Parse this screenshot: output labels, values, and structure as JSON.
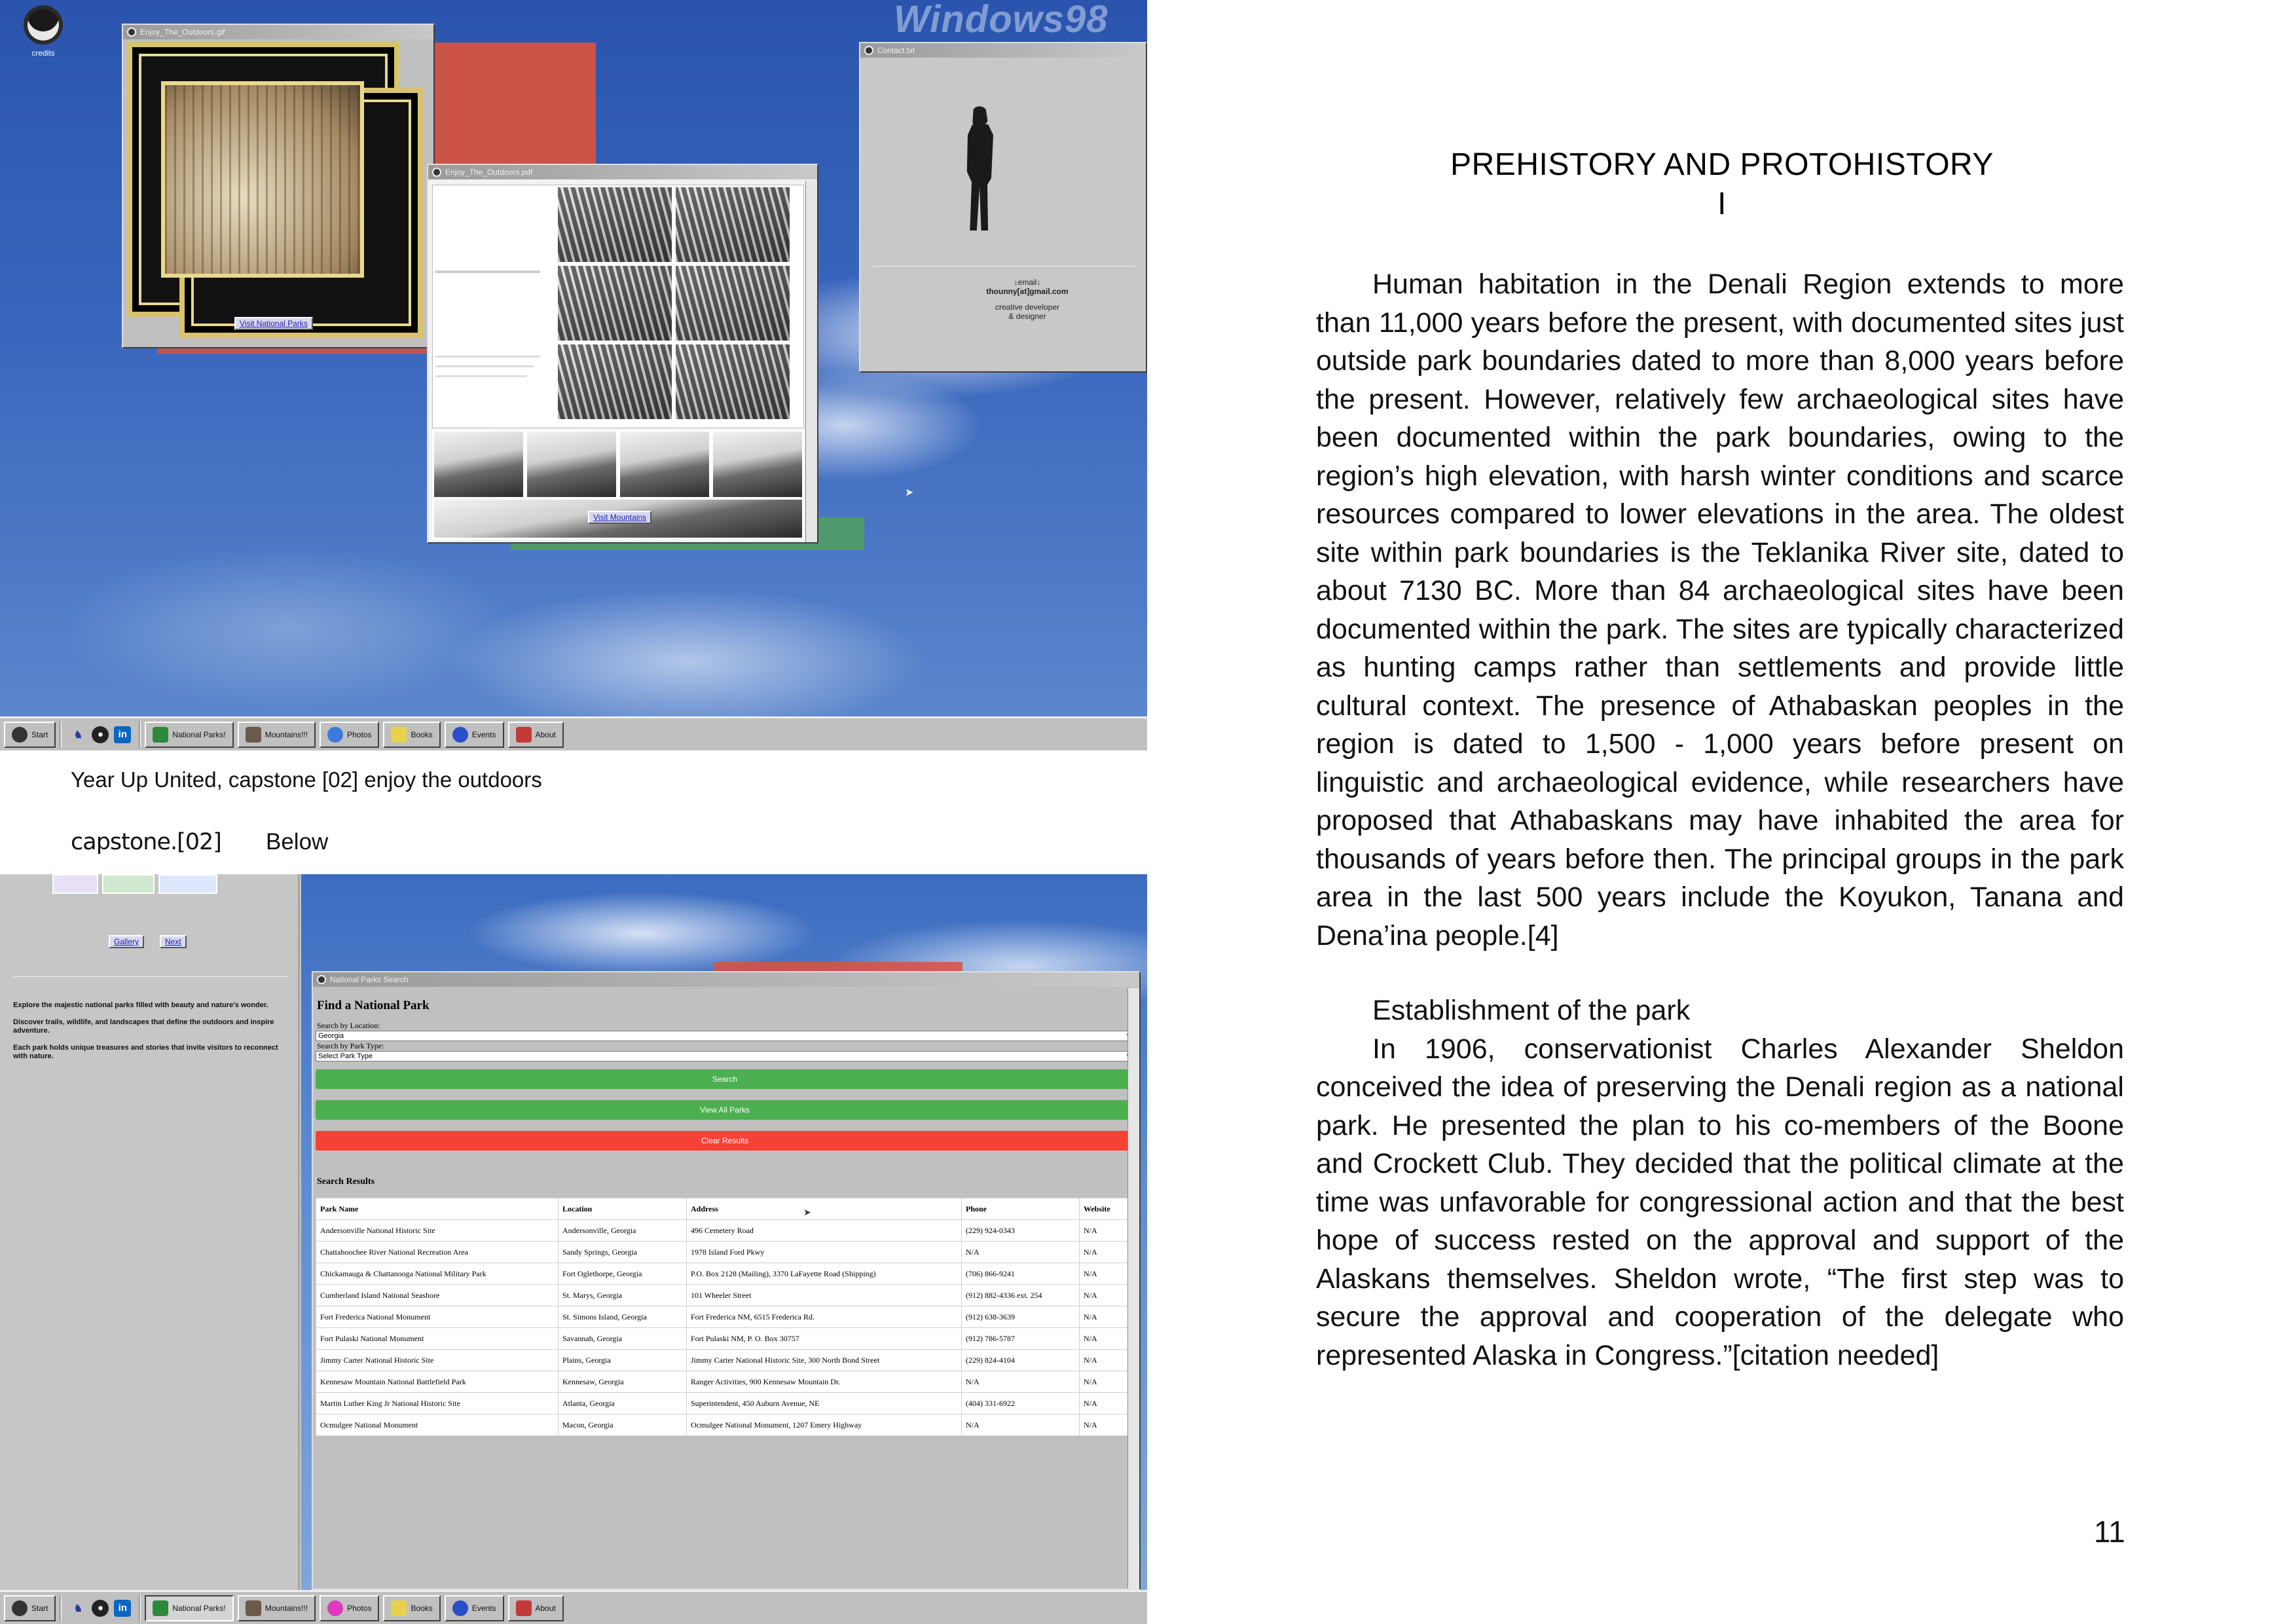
{
  "screenshot1": {
    "os_watermark": "Windows98",
    "desktop_icon_label": "credits",
    "gallery_window": {
      "title": "Enjoy_The_Outdoors.gif",
      "visit_link": "Visit National Parks"
    },
    "pdf_window": {
      "title": "Enjoy_The_Outdoors.pdf",
      "visit_link": "Visit Mountains"
    },
    "contact_window": {
      "title": "Contact.txt",
      "email_label": "↓email↓",
      "email": "thounny[at]gmail.com",
      "role_line1": "creative developer",
      "role_line2": "& designer"
    },
    "taskbar": {
      "start": "Start",
      "items": [
        "National Parks!",
        "Mountains!!!",
        "Photos",
        "Books",
        "Events",
        "About"
      ]
    }
  },
  "caption": {
    "line1": "Year Up United, capstone [02] enjoy the outdoors",
    "brand": "capstone.[02]",
    "below": "Below"
  },
  "screenshot2": {
    "sidebar": {
      "gallery_button": "Gallery",
      "next_button": "Next",
      "paragraphs": [
        "Explore the majestic national parks filled with beauty and nature's wonder.",
        "Discover trails, wildlife, and landscapes that define the outdoors and inspire adventure.",
        "Each park holds unique treasures and stories that invite visitors to reconnect with nature."
      ]
    },
    "search_window": {
      "title": "National Parks Search",
      "heading": "Find a National Park",
      "location_label": "Search by Location:",
      "location_value": "Georgia",
      "type_label": "Search by Park Type:",
      "type_value": "Select Park Type",
      "search_button": "Search",
      "view_all_button": "View All Parks",
      "clear_button": "Clear Results",
      "results_heading": "Search Results",
      "columns": [
        "Park Name",
        "Location",
        "Address",
        "Phone",
        "Website"
      ],
      "rows": [
        [
          "Andersonville National Historic Site",
          "Andersonville, Georgia",
          "496 Cemetery Road",
          "(229) 924-0343",
          "N/A"
        ],
        [
          "Chattahoochee River National Recreation Area",
          "Sandy Springs, Georgia",
          "1978 Island Ford Pkwy",
          "N/A",
          "N/A"
        ],
        [
          "Chickamauga & Chattanooga National Military Park",
          "Fort Oglethorpe, Georgia",
          "P.O. Box 2128 (Mailing), 3370 LaFayette Road (Shipping)",
          "(706) 866-9241",
          "N/A"
        ],
        [
          "Cumberland Island National Seashore",
          "St. Marys, Georgia",
          "101 Wheeler Street",
          "(912) 882-4336 ext. 254",
          "N/A"
        ],
        [
          "Fort Frederica National Monument",
          "St. Simons Island, Georgia",
          "Fort Frederica NM, 6515 Frederica Rd.",
          "(912) 638-3639",
          "N/A"
        ],
        [
          "Fort Pulaski National Monument",
          "Savannah, Georgia",
          "Fort Pulaski NM, P. O. Box 30757",
          "(912) 786-5787",
          "N/A"
        ],
        [
          "Jimmy Carter National Historic Site",
          "Plains, Georgia",
          "Jimmy Carter National Historic Site, 300 North Bond Street",
          "(229) 824-4104",
          "N/A"
        ],
        [
          "Kennesaw Mountain National Battlefield Park",
          "Kennesaw, Georgia",
          "Ranger Activities, 900 Kennesaw Mountain Dr.",
          "N/A",
          "N/A"
        ],
        [
          "Martin Luther King Jr National Historic Site",
          "Atlanta, Georgia",
          "Superintendent, 450 Auburn Avenue, NE",
          "(404) 331-6922",
          "N/A"
        ],
        [
          "Ocmulgee National Monument",
          "Macon, Georgia",
          "Ocmulgee National Monument, 1207 Emery Highway",
          "N/A",
          "N/A"
        ]
      ]
    },
    "taskbar": {
      "start": "Start",
      "items": [
        "National Parks!",
        "Mountains!!!",
        "Photos",
        "Books",
        "Events",
        "About"
      ]
    }
  },
  "article": {
    "title": "PREHISTORY AND PROTOHISTORY",
    "title_mark": "I",
    "paragraph1": "Human habitation in the Denali Region extends to more than 11,000 years before the present, with documented sites just outside park boundaries dated to more than 8,000 years before the present. However, relatively few archaeological sites have been documented within the park boundaries, owing to the region’s high elevation, with harsh winter conditions and scarce resources compared to lower elevations in the area. The oldest site within park boundaries is the Teklanika River site, dated to about 7130 BC. More than 84 archaeological sites have been documented within the park. The sites are typically characterized as hunting camps rather than settlements and provide little cultural context. The presence of Athabaskan peoples in the region is dated to 1,500 - 1,000 years before present on linguistic and archaeological evidence, while researchers have proposed that Athabaskans may have inhabited the area for thousands of years before then. The principal groups in the park area in the last 500 years include the Koyukon, Tanana and Dena’ina people.[4]",
    "subheading": "Establishment of the park",
    "paragraph2": "In 1906, conservationist Charles Alexander Sheldon conceived the idea of preserving the Denali region as a national park. He presented the plan to his co-members of the Boone and Crockett Club. They decided that the political climate at the time was unfavorable for congressional action and that the best hope of success rested on the approval and support of the Alaskans themselves. Sheldon wrote, “The first step was to secure the approval and cooperation of the delegate who represented Alaska in Congress.”[citation needed]",
    "page_number": "11"
  }
}
